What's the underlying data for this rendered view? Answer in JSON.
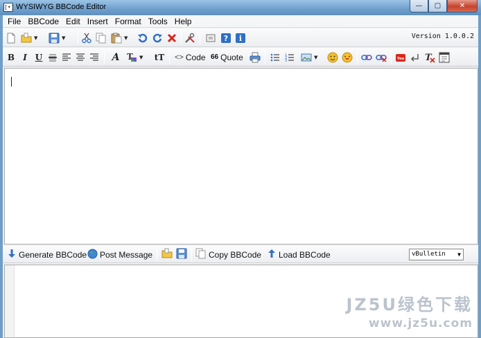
{
  "window": {
    "title": "WYSIWYG BBCode Editor",
    "app_icon": "[•]",
    "controls": {
      "minimize": "—",
      "maximize": "▢",
      "close": "✕"
    }
  },
  "menu": [
    "File",
    "BBCode",
    "Edit",
    "Insert",
    "Format",
    "Tools",
    "Help"
  ],
  "toolbar1": {
    "version": "Version 1.0.0.2",
    "icons": [
      "new-file-icon",
      "open-folder-icon",
      "save-icon",
      "cut-icon",
      "copy-icon",
      "paste-icon",
      "undo-icon",
      "redo-icon",
      "delete-icon",
      "tools-icon",
      "window-icon",
      "help-icon",
      "info-icon"
    ]
  },
  "toolbar2": {
    "bold": "B",
    "italic": "I",
    "underline": "U",
    "strike": "S",
    "font": "A",
    "size": "tT",
    "code_label": "Code",
    "code_glyph": "<>",
    "quote_label": "Quote",
    "quote_glyph": "66"
  },
  "bottombar": {
    "generate_label": "Generate BBCode",
    "post_label": "Post Message",
    "copy_label": "Copy BBCode",
    "load_label": "Load BBCode",
    "format_select": "vBulletin"
  },
  "watermark": {
    "line1": "JZ5U绿色下载",
    "line2": "www.jz5u.com"
  },
  "colors": {
    "accent_blue": "#2f6fc4",
    "red": "#d9261c",
    "titlebar": "#6e9fcc"
  }
}
